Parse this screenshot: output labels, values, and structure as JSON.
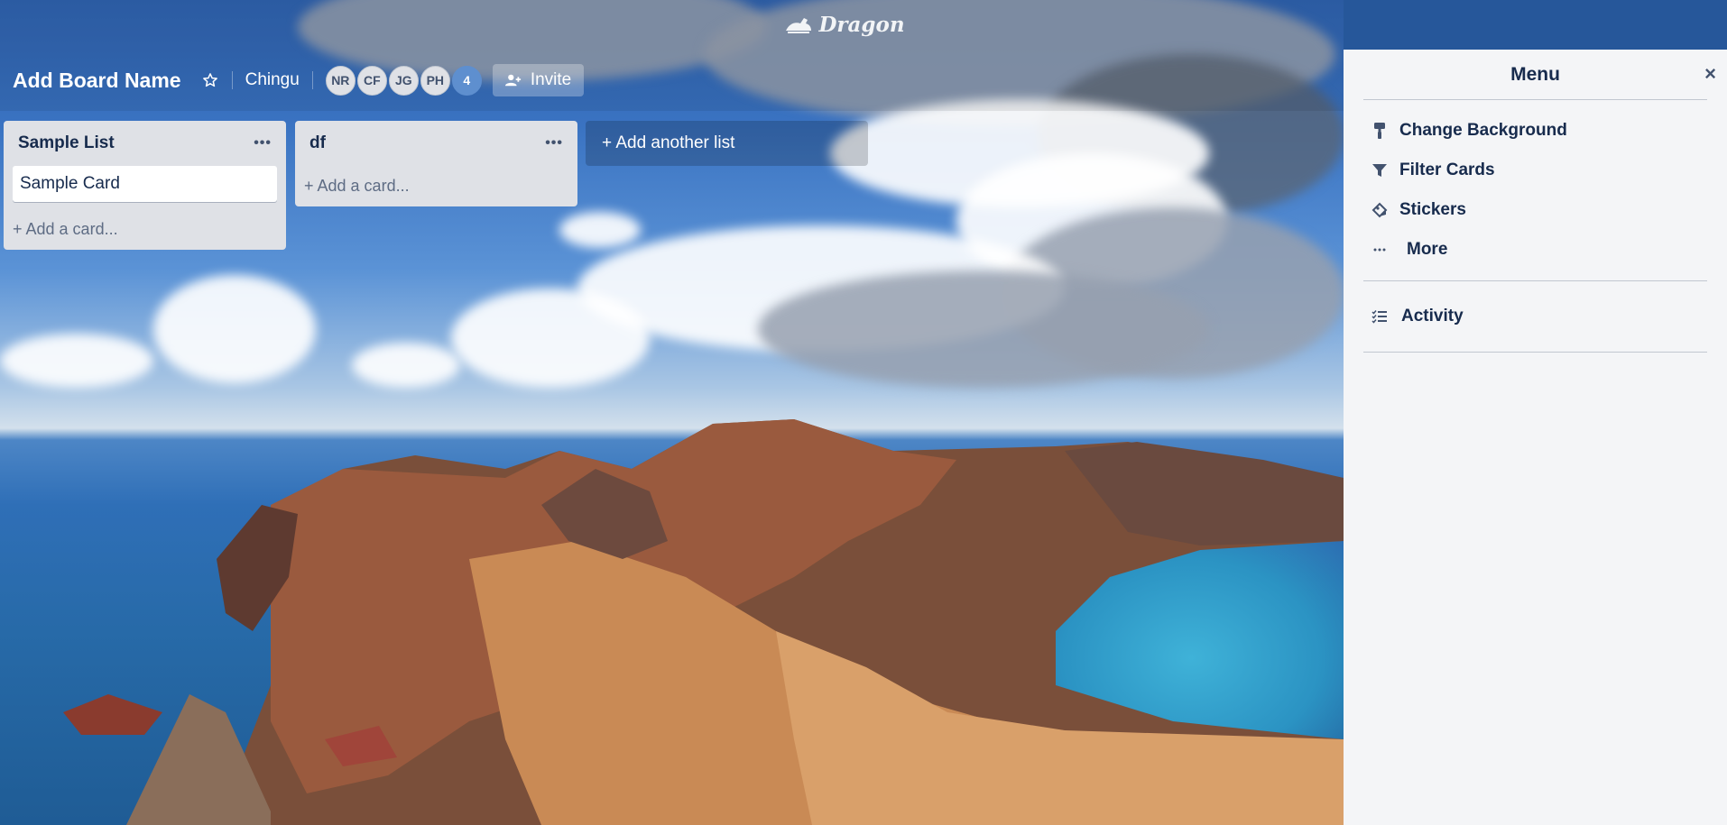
{
  "app": {
    "logo_text": "Dragon"
  },
  "board": {
    "title": "Add Board Name",
    "team": "Chingu",
    "members": [
      "NR",
      "CF",
      "JG",
      "PH"
    ],
    "member_count": "4",
    "invite_label": "Invite"
  },
  "lists": [
    {
      "title": "Sample List",
      "menu": "•••",
      "cards": [
        "Sample Card"
      ],
      "add_card": "+ Add a card..."
    },
    {
      "title": "df",
      "menu": "•••",
      "cards": [],
      "add_card": "+ Add a card..."
    }
  ],
  "add_list_label": "+ Add another list",
  "menu": {
    "title": "Menu",
    "close": "×",
    "items": [
      {
        "label": "Change Background",
        "icon": "paint-roller-icon"
      },
      {
        "label": "Filter Cards",
        "icon": "filter-icon"
      },
      {
        "label": "Stickers",
        "icon": "sticker-icon"
      },
      {
        "label": "More",
        "icon": "more-dots-icon"
      }
    ],
    "activity_label": "Activity",
    "activity_icon": "activity-list-icon"
  }
}
